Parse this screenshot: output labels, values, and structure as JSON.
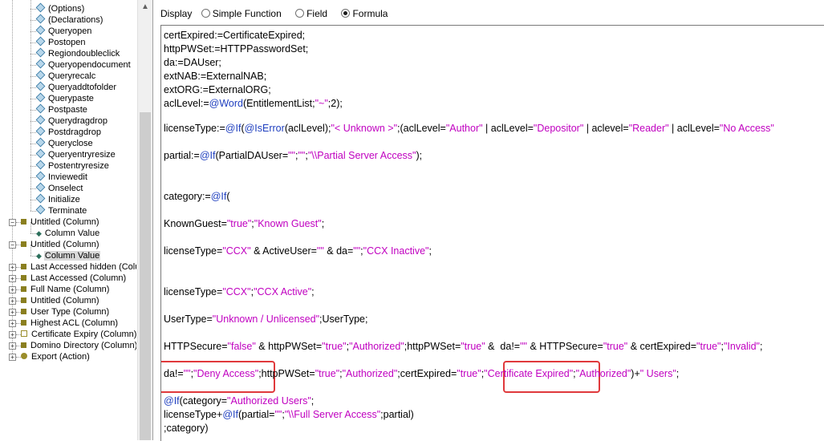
{
  "tree": {
    "events": [
      "(Options)",
      "(Declarations)",
      "Queryopen",
      "Postopen",
      "Regiondoubleclick",
      "Queryopendocument",
      "Queryrecalc",
      "Queryaddtofolder",
      "Querypaste",
      "Postpaste",
      "Querydragdrop",
      "Postdragdrop",
      "Queryclose",
      "Queryentryresize",
      "Postentryresize",
      "Inviewedit",
      "Onselect",
      "Initialize",
      "Terminate"
    ],
    "column1": {
      "label": "Untitled (Column)",
      "child": "Column Value"
    },
    "column2": {
      "label": "Untitled (Column)",
      "child": "Column Value"
    },
    "collapsed": [
      "Last Accessed hidden (Colu",
      "Last Accessed (Column)",
      "Full Name (Column)",
      "Untitled (Column)",
      "User Type (Column)",
      "Highest ACL (Column)",
      "Certificate Expiry (Column)",
      "Domino Directory (Column)",
      "Export (Action)"
    ],
    "expand_glyph": "+",
    "collapse_glyph": "−",
    "scroll_up_glyph": "▲"
  },
  "display": {
    "label": "Display",
    "options": [
      "Simple Function",
      "Field",
      "Formula"
    ],
    "selected": "Formula"
  },
  "code": [
    [
      [
        "t",
        "certExpired:=CertificateExpired;"
      ]
    ],
    [
      [
        "t",
        "httpPWSet:=HTTPPasswordSet;"
      ]
    ],
    [
      [
        "t",
        "da:=DAUser;"
      ]
    ],
    [
      [
        "t",
        "extNAB:=ExternalNAB;"
      ]
    ],
    [
      [
        "t",
        "extORG:=ExternalORG;"
      ]
    ],
    [
      [
        "t",
        "aclLevel:="
      ],
      [
        "f",
        "@Word"
      ],
      [
        "t",
        "(EntitlementList;"
      ],
      [
        "s",
        "\"~\""
      ],
      [
        "t",
        ";2);"
      ]
    ],
    [
      [
        "t",
        "licenseType:="
      ],
      [
        "f",
        "@If"
      ],
      [
        "t",
        "("
      ],
      [
        "f",
        "@IsError"
      ],
      [
        "t",
        "(aclLevel);"
      ],
      [
        "s",
        "\"< Unknown >\""
      ],
      [
        "t",
        ";(aclLevel="
      ],
      [
        "s",
        "\"Author\""
      ],
      [
        "t",
        " | aclLevel="
      ],
      [
        "s",
        "\"Depositor\""
      ],
      [
        "t",
        " | aclevel="
      ],
      [
        "s",
        "\"Reader\""
      ],
      [
        "t",
        " | aclLevel="
      ],
      [
        "s",
        "\"No Access\""
      ]
    ],
    [
      [
        "t",
        "partial:="
      ],
      [
        "f",
        "@If"
      ],
      [
        "t",
        "(PartialDAUser="
      ],
      [
        "s",
        "\"\""
      ],
      [
        "t",
        ";"
      ],
      [
        "s",
        "\"\""
      ],
      [
        "t",
        ";"
      ],
      [
        "s",
        "\"\\\\Partial Server Access\""
      ],
      [
        "t",
        ");"
      ]
    ],
    [
      [
        "t",
        "category:="
      ],
      [
        "f",
        "@If"
      ],
      [
        "t",
        "("
      ]
    ],
    [
      [
        "t",
        "KnownGuest="
      ],
      [
        "s",
        "\"true\""
      ],
      [
        "t",
        ";"
      ],
      [
        "s",
        "\"Known Guest\""
      ],
      [
        "t",
        ";"
      ]
    ],
    [
      [
        "t",
        "licenseType="
      ],
      [
        "s",
        "\"CCX\""
      ],
      [
        "t",
        " & ActiveUser="
      ],
      [
        "s",
        "\"\""
      ],
      [
        "t",
        " & da="
      ],
      [
        "s",
        "\"\""
      ],
      [
        "t",
        ";"
      ],
      [
        "s",
        "\"CCX Inactive\""
      ],
      [
        "t",
        ";"
      ]
    ],
    [
      [
        "t",
        "licenseType="
      ],
      [
        "s",
        "\"CCX\""
      ],
      [
        "t",
        ";"
      ],
      [
        "s",
        "\"CCX Active\""
      ],
      [
        "t",
        ";"
      ]
    ],
    [
      [
        "t",
        "UserType="
      ],
      [
        "s",
        "\"Unknown / Unlicensed\""
      ],
      [
        "t",
        ";UserType;"
      ]
    ],
    [
      [
        "t",
        "HTTPSecure="
      ],
      [
        "s",
        "\"false\""
      ],
      [
        "t",
        " & httpPWSet="
      ],
      [
        "s",
        "\"true\""
      ],
      [
        "t",
        ";"
      ],
      [
        "s",
        "\"Authorized\""
      ],
      [
        "t",
        ";httpPWSet="
      ],
      [
        "s",
        "\"true\""
      ],
      [
        "t",
        " &  da!="
      ],
      [
        "s",
        "\"\""
      ],
      [
        "t",
        " & HTTPSecure="
      ],
      [
        "s",
        "\"true\""
      ],
      [
        "t",
        " & certExpired="
      ],
      [
        "s",
        "\"true\""
      ],
      [
        "t",
        ";"
      ],
      [
        "s",
        "\"Invalid\""
      ],
      [
        "t",
        ";"
      ]
    ],
    [
      [
        "t",
        "da!="
      ],
      [
        "s",
        "\"\""
      ],
      [
        "t",
        ";"
      ],
      [
        "s",
        "\"Deny Access\""
      ],
      [
        "t",
        ";httpPWSet="
      ],
      [
        "s",
        "\"true\""
      ],
      [
        "t",
        ";"
      ],
      [
        "s",
        "\"Authorized\""
      ],
      [
        "t",
        ";certExpired="
      ],
      [
        "s",
        "\"true\""
      ],
      [
        "t",
        ";"
      ],
      [
        "s",
        "\"Certificate Expired\""
      ],
      [
        "t",
        ";"
      ],
      [
        "s",
        "\"Authorized\""
      ],
      [
        "t",
        ")+"
      ],
      [
        "s",
        "\" Users\""
      ],
      [
        "t",
        ";"
      ]
    ],
    [
      [
        "f",
        "@If"
      ],
      [
        "t",
        "(category="
      ],
      [
        "s",
        "\"Authorized Users\""
      ],
      [
        "t",
        ";"
      ]
    ],
    [
      [
        "t",
        "licenseType+"
      ],
      [
        "f",
        "@If"
      ],
      [
        "t",
        "(partial="
      ],
      [
        "s",
        "\"\""
      ],
      [
        "t",
        ";"
      ],
      [
        "s",
        "\"\\\\Full Server Access\""
      ],
      [
        "t",
        ";partial)"
      ]
    ],
    [
      [
        "t",
        ";category)"
      ]
    ]
  ]
}
